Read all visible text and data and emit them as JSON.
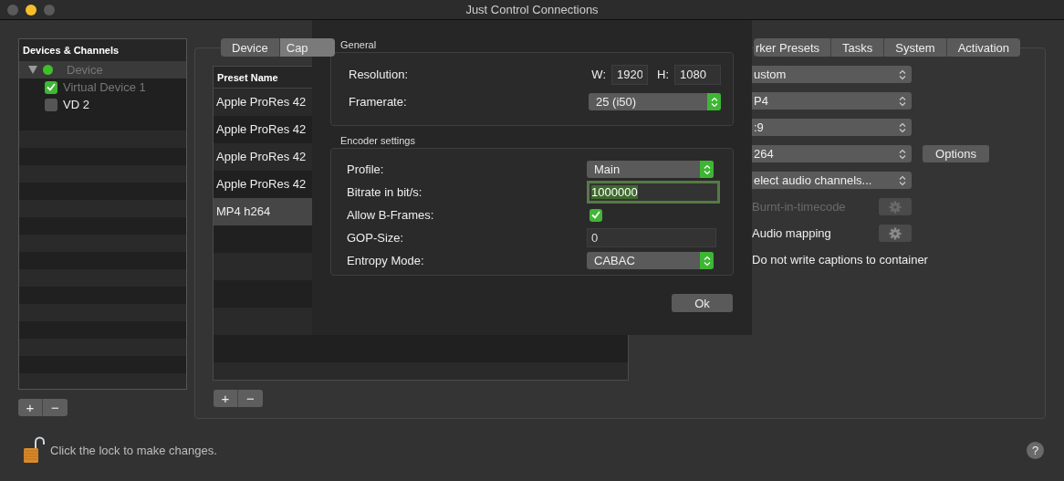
{
  "window": {
    "title": "Just Control Connections"
  },
  "devices_panel": {
    "header": "Devices & Channels",
    "tree": [
      {
        "label": "Device",
        "expanded": true,
        "selected": true,
        "disabled": true,
        "color": "#3fbf2a",
        "children": [
          {
            "label": "Virtual Device 1",
            "checked": true,
            "disabled": true
          },
          {
            "label": "VD 2",
            "checked": false,
            "disabled": false
          }
        ]
      }
    ],
    "buttons": [
      "+",
      "−"
    ]
  },
  "tabs_left": [
    {
      "label": "Device",
      "selected": false
    },
    {
      "label": "Cap",
      "selected": true
    }
  ],
  "tabs_right": [
    {
      "label": "rker Presets",
      "selected": false
    },
    {
      "label": "Tasks",
      "selected": false
    },
    {
      "label": "System",
      "selected": false
    },
    {
      "label": "Activation",
      "selected": false
    }
  ],
  "preset_table": {
    "columns": [
      "Preset Name"
    ],
    "rows": [
      {
        "name": "Apple ProRes 42",
        "selected": false
      },
      {
        "name": "Apple ProRes 42",
        "selected": false
      },
      {
        "name": "Apple ProRes 42",
        "selected": false
      },
      {
        "name": "Apple ProRes 42",
        "selected": false
      },
      {
        "name": "MP4 h264",
        "selected": true
      }
    ],
    "buttons": [
      "+",
      "−"
    ]
  },
  "settings": {
    "popups": [
      {
        "value": "ustom"
      },
      {
        "value": "P4"
      },
      {
        "value": ":9"
      },
      {
        "value": "264"
      },
      {
        "value": "elect audio channels..."
      }
    ],
    "options_button": "Options",
    "gear_rows": [
      {
        "label": "Burnt-in-timecode",
        "disabled": true
      },
      {
        "label": "Audio mapping",
        "disabled": false
      }
    ],
    "captions_label": "Do not write captions to container"
  },
  "sheet": {
    "general": {
      "title": "General",
      "resolution_label": "Resolution:",
      "w_label": "W:",
      "w_value": "1920",
      "h_label": "H:",
      "h_value": "1080",
      "framerate_label": "Framerate:",
      "framerate_value": "25 (i50)"
    },
    "encoder": {
      "title": "Encoder settings",
      "fields": [
        {
          "kind": "popup",
          "label": "Profile:",
          "value": "Main"
        },
        {
          "kind": "text",
          "label": "Bitrate in bit/s:",
          "value": "1000000",
          "focused": true
        },
        {
          "kind": "checkbox",
          "label": "Allow B-Frames:",
          "checked": true
        },
        {
          "kind": "text",
          "label": "GOP-Size:",
          "value": "0",
          "focused": false
        },
        {
          "kind": "popup",
          "label": "Entropy Mode:",
          "value": "CABAC"
        }
      ]
    },
    "ok_button": "Ok"
  },
  "footer": {
    "lock_text": "Click the lock to make changes.",
    "help": "?"
  }
}
